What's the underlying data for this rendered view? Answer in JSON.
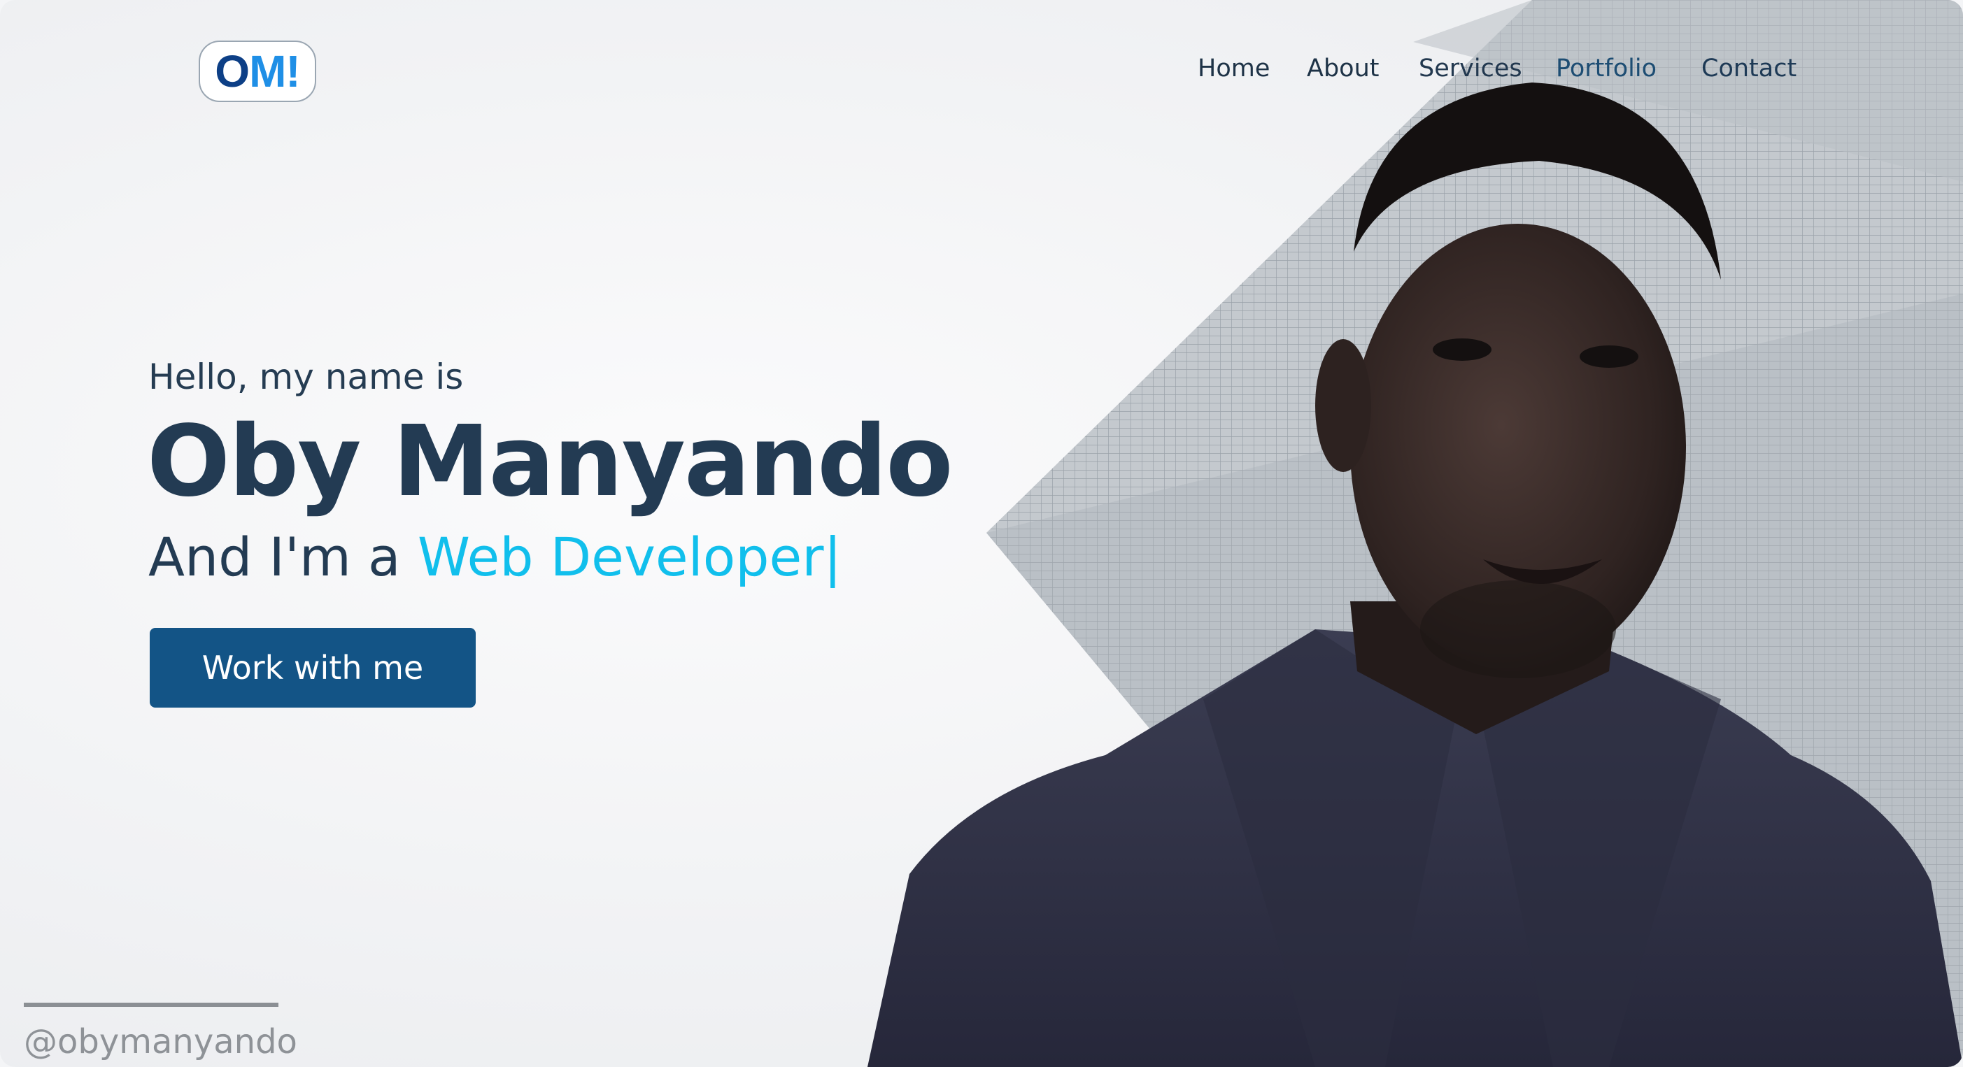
{
  "logo": {
    "part1": "O",
    "part2": "M!"
  },
  "nav": {
    "home": "Home",
    "about": "About",
    "services": "Services",
    "portfolio": "Portfolio",
    "contact": "Contact"
  },
  "hero": {
    "greeting": "Hello, my name is",
    "name": "Oby Manyando",
    "role_prefix": "And I'm a",
    "role": "Web Developer",
    "caret": "|",
    "cta_label": "Work with me"
  },
  "social": {
    "handle": "@obymanyando"
  },
  "colors": {
    "primary_button": "#135486",
    "accent": "#11bfec",
    "heading": "#233b53"
  },
  "icons": {
    "portrait": "portrait-photo",
    "building": "building-background"
  }
}
